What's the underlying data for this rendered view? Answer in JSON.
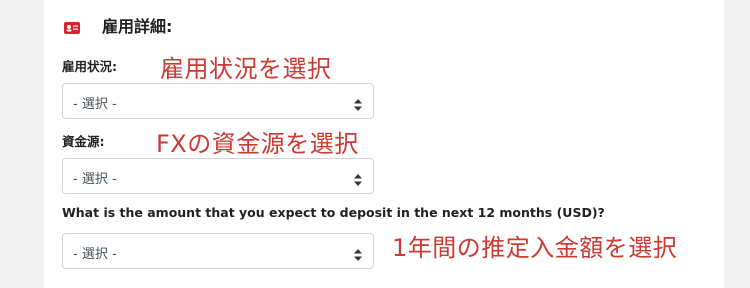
{
  "section": {
    "icon": "id-card-icon",
    "title": "雇用詳細:"
  },
  "fields": [
    {
      "label": "雇用状況:",
      "select_value": "- 選択 -",
      "annotation": "雇用状況を選択"
    },
    {
      "label": "資金源:",
      "select_value": "- 選択 -",
      "annotation": "FXの資金源を選択"
    },
    {
      "label": "What is the amount that you expect to deposit in the next 12 months (USD)?",
      "select_value": "- 選択 -",
      "annotation": "1年間の推定入金額を選択"
    }
  ],
  "colors": {
    "accent": "#d9252a",
    "annotation": "#cc3a33",
    "background": "#f1f1f1",
    "panel": "#ffffff"
  }
}
